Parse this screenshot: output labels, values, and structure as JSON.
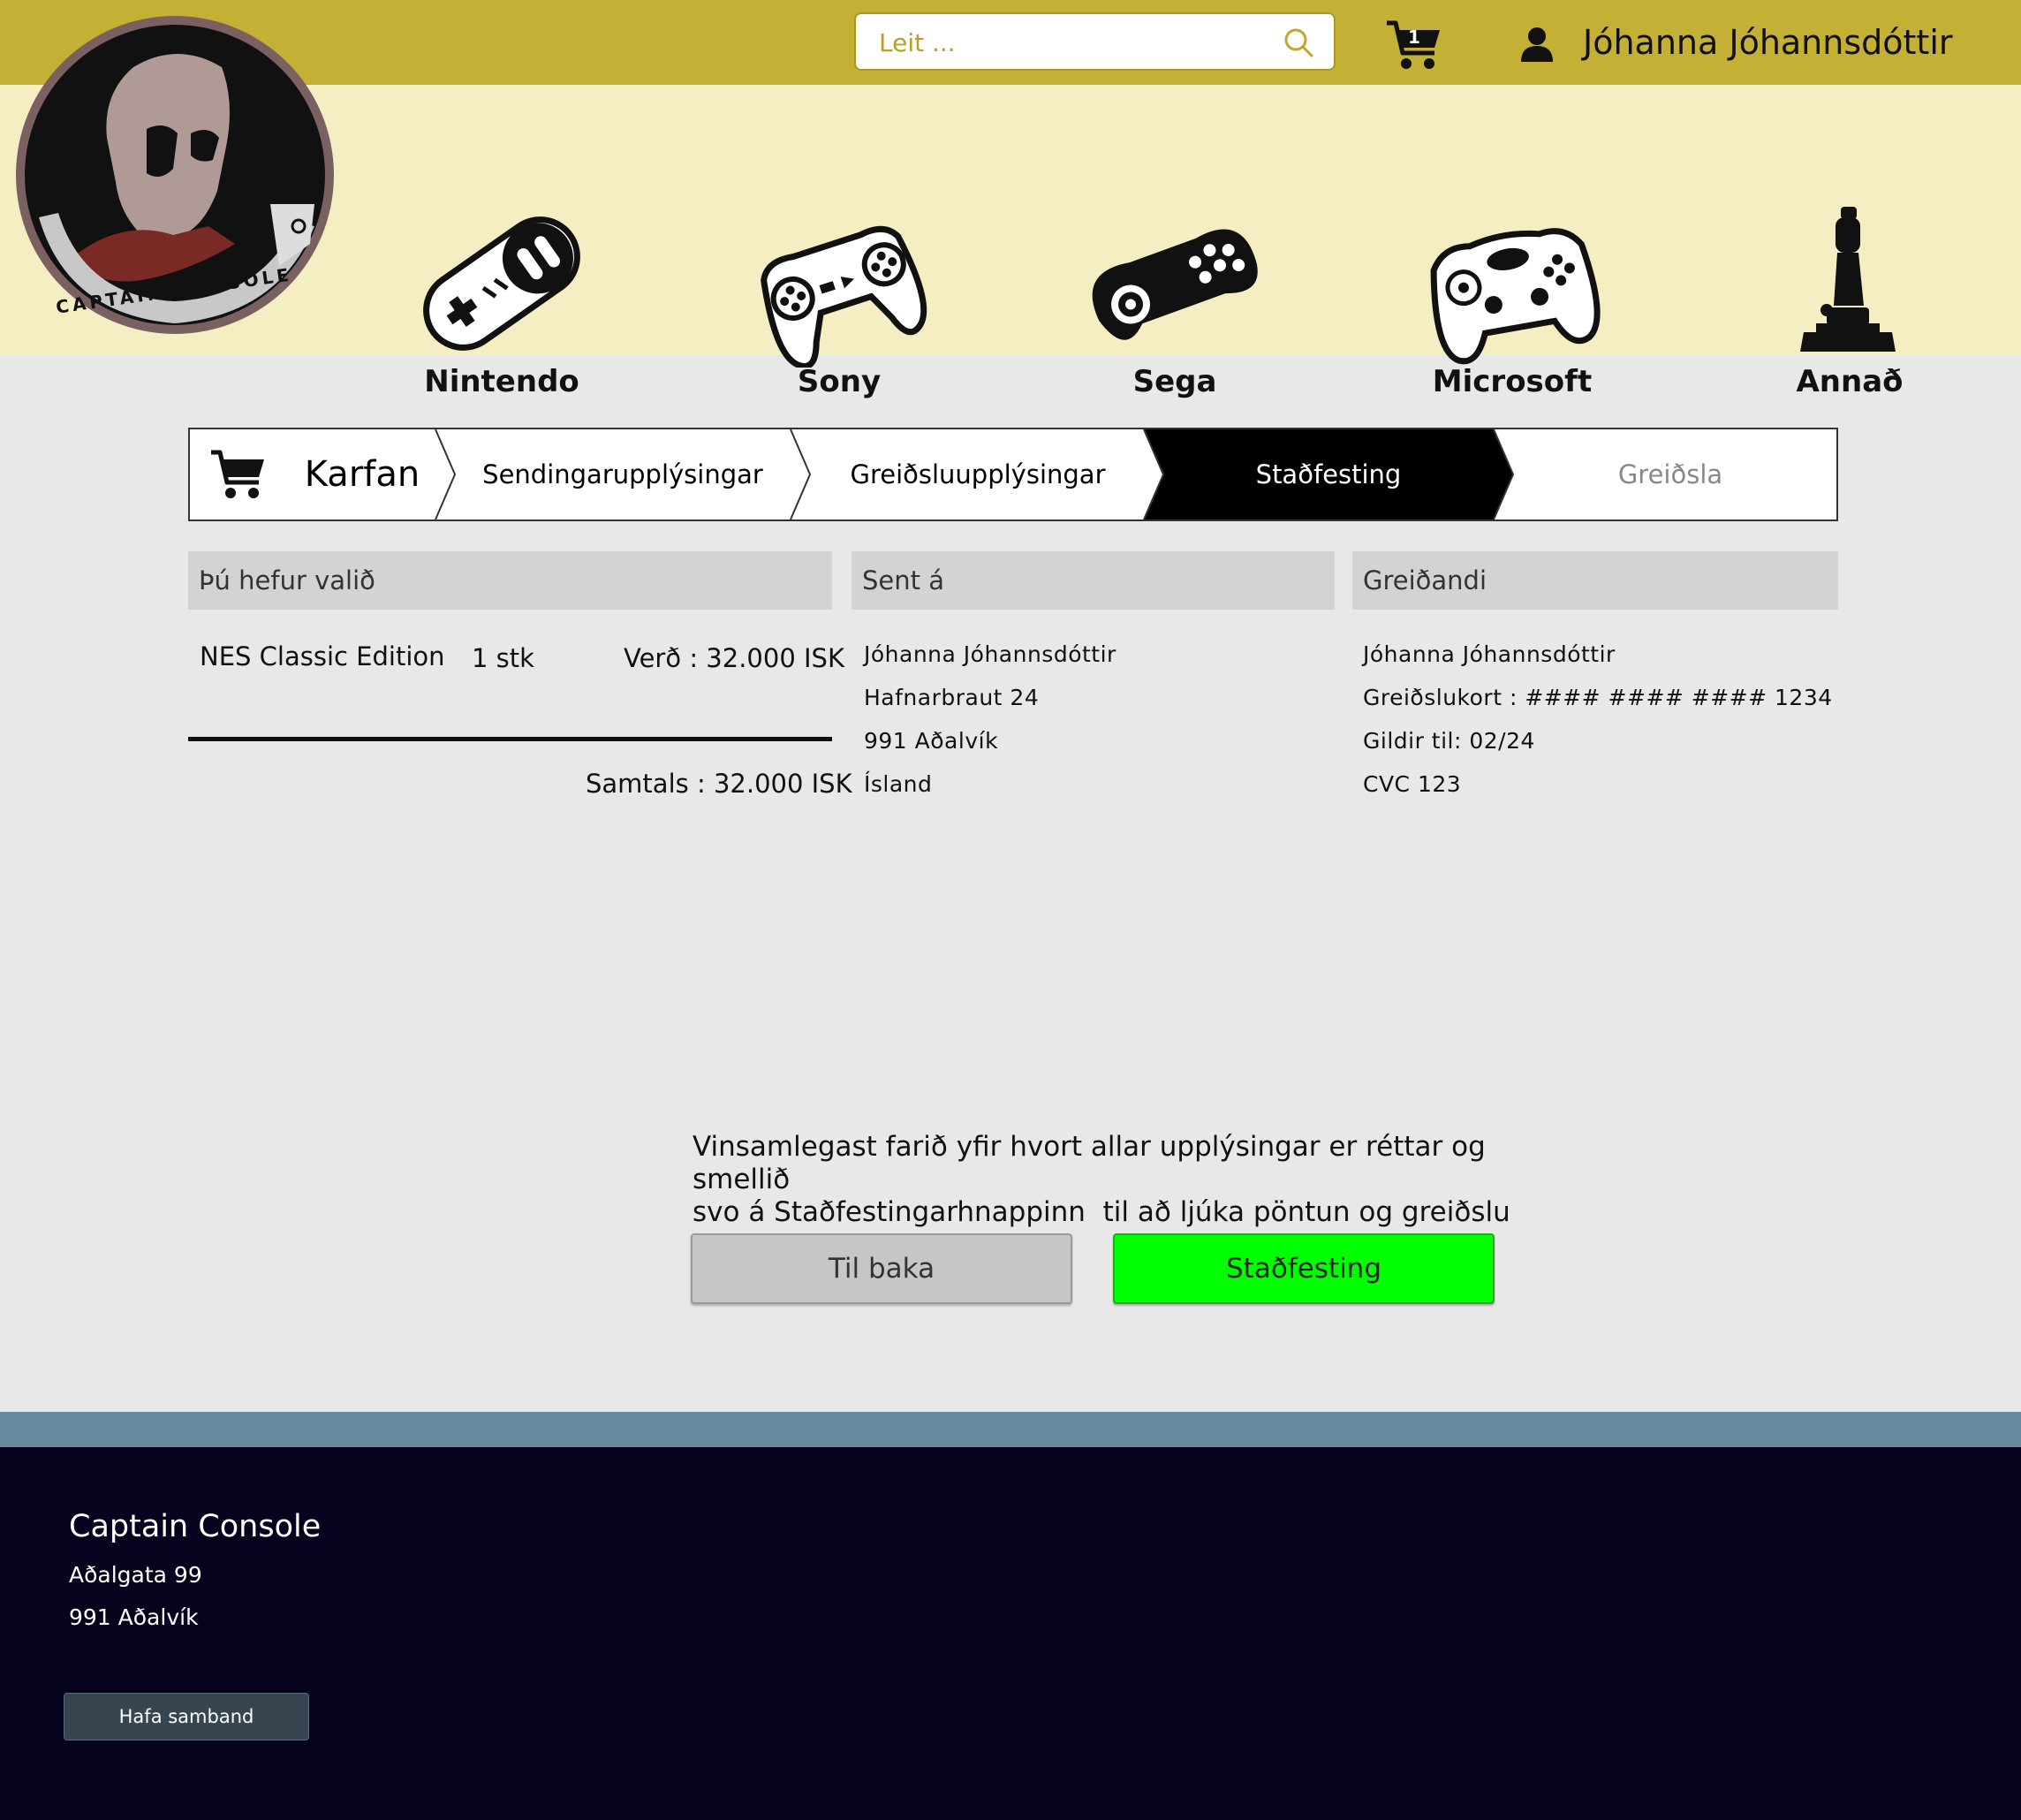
{
  "header": {
    "search_placeholder": "Leit ...",
    "cart_count": "1",
    "user_name": "Jóhanna Jóhannsdóttir",
    "bar_color": "#c4b034"
  },
  "logo": {
    "text": "CAPTAIN CONSOLE"
  },
  "categories": [
    {
      "label": "Nintendo",
      "icon": "nintendo-controller-icon"
    },
    {
      "label": "Sony",
      "icon": "sony-controller-icon"
    },
    {
      "label": "Sega",
      "icon": "sega-controller-icon"
    },
    {
      "label": "Microsoft",
      "icon": "xbox-controller-icon"
    },
    {
      "label": "Annað",
      "icon": "joystick-icon"
    }
  ],
  "steps": [
    {
      "label": "Karfan",
      "state": "done"
    },
    {
      "label": "Sendingarupplýsingar",
      "state": "done"
    },
    {
      "label": "Greiðsluupplýsingar",
      "state": "done"
    },
    {
      "label": "Staðfesting",
      "state": "active"
    },
    {
      "label": "Greiðsla",
      "state": "pending"
    }
  ],
  "order": {
    "heading": "Þú hefur valið",
    "item_name": "NES Classic Edition",
    "quantity": "1 stk",
    "price": "Verð : 32.000 ISK",
    "total": "Samtals : 32.000 ISK"
  },
  "shipping": {
    "heading": "Sent á",
    "lines": [
      "Jóhanna Jóhannsdóttir",
      "Hafnarbraut 24",
      "991 Aðalvík",
      "Ísland"
    ]
  },
  "payer": {
    "heading": "Greiðandi",
    "lines": [
      "Jóhanna Jóhannsdóttir",
      "Greiðslukort : #### #### #### 1234",
      "Gildir til: 02/24",
      "CVC 123"
    ]
  },
  "message": {
    "line1": "Vinsamlegast farið yfir hvort allar upplýsingar er réttar og smellið",
    "line2": "svo á Staðfestingarhnappinn  til að ljúka pöntun og greiðslu"
  },
  "buttons": {
    "back": "Til baka",
    "confirm": "Staðfesting",
    "confirm_color": "#00ff00"
  },
  "footer": {
    "company": "Captain Console",
    "address1": "Aðalgata 99",
    "address2": "991 Aðalvík",
    "contact_button": "Hafa samband"
  }
}
